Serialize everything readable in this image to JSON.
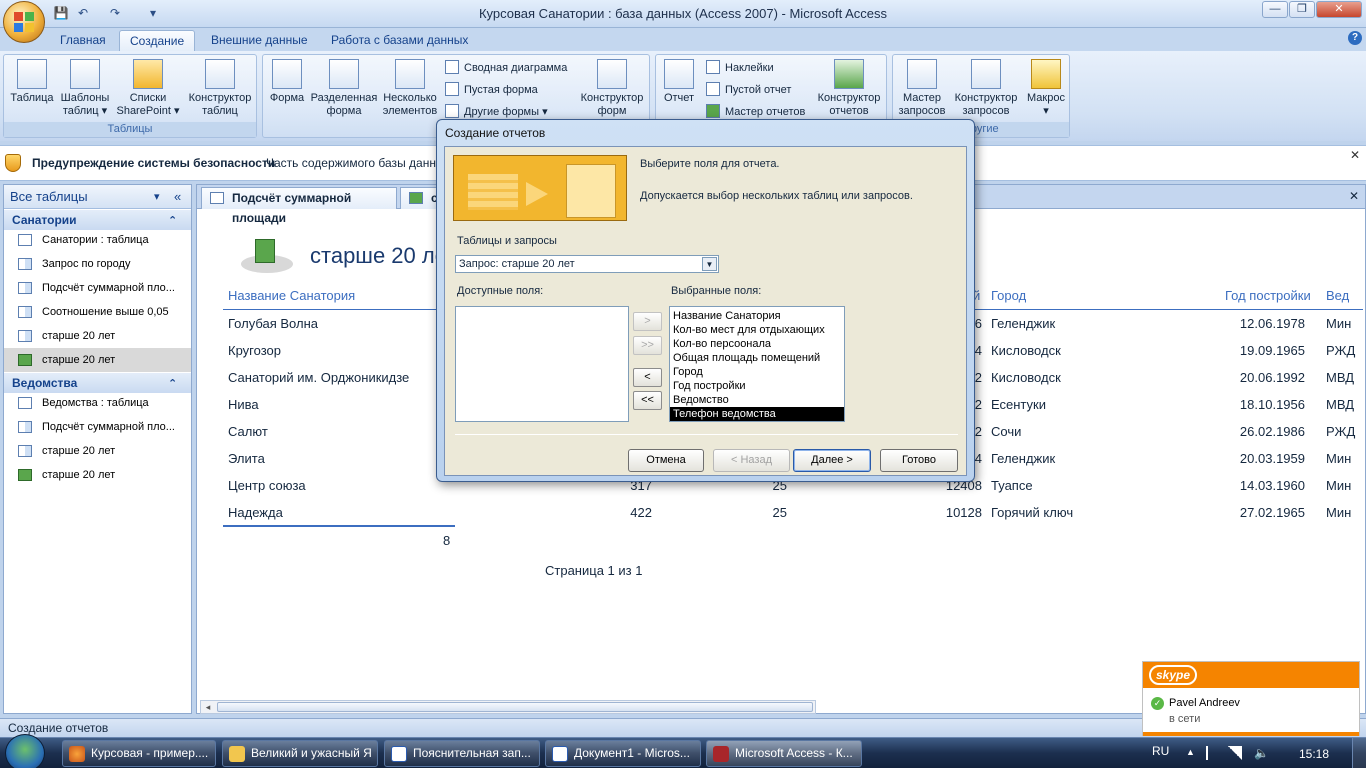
{
  "window": {
    "title": "Курсовая Санатории : база данных (Access 2007) - Microsoft Access"
  },
  "qat": {
    "save": "💾",
    "undo": "↶",
    "redo": "↷",
    "more": "▾"
  },
  "winbuttons": {
    "minimize": "—",
    "maximize": "❐",
    "close": "✕"
  },
  "ribbon_tabs": [
    "Главная",
    "Создание",
    "Внешние данные",
    "Работа с базами данных"
  ],
  "ribbon_help": "?",
  "ribbon": {
    "tables": {
      "label": "Таблицы",
      "btn1": "Таблица",
      "btn2a": "Шаблоны",
      "btn2b": "таблиц ▾",
      "btn3a": "Списки",
      "btn3b": "SharePoint ▾",
      "btn4a": "Конструктор",
      "btn4b": "таблиц"
    },
    "forms": {
      "btn1": "Форма",
      "btn2a": "Разделенная",
      "btn2b": "форма",
      "btn3a": "Несколько",
      "btn3b": "элементов",
      "s1": "Сводная диаграмма",
      "s2": "Пустая форма",
      "s3": "Другие формы ▾",
      "btn4a": "Конструктор",
      "btn4b": "форм"
    },
    "reports": {
      "btn1": "Отчет",
      "s1": "Наклейки",
      "s2": "Пустой отчет",
      "s3": "Мастер отчетов",
      "btn2a": "Конструктор",
      "btn2b": "отчетов"
    },
    "other": {
      "label": "Другие",
      "btn1a": "Мастер",
      "btn1b": "запросов",
      "btn2a": "Конструктор",
      "btn2b": "запросов",
      "btn3": "Макрос",
      "btn3b": "▾"
    }
  },
  "security": {
    "title": "Предупреждение системы безопасности",
    "text": "Часть содержимого базы данны",
    "close": "✕"
  },
  "nav": {
    "header": "Все таблицы",
    "header_arrow": "▾",
    "header_collapse": "«",
    "group1": {
      "name": "Санатории",
      "toggle": "⌃",
      "items": [
        "Санатории : таблица",
        "Запрос по городу",
        "Подсчёт суммарной пло...",
        "Соотношение выше 0,05",
        "старше 20 лет",
        "старше 20 лет"
      ]
    },
    "group2": {
      "name": "Ведомства",
      "toggle": "⌃",
      "items": [
        "Ведомства : таблица",
        "Подсчёт суммарной пло...",
        "старше 20 лет",
        "старше 20 лет"
      ]
    }
  },
  "doc": {
    "tab1": "Подсчёт суммарной площади",
    "tab2": "с",
    "close": "✕",
    "report_title": "старше 20 ле",
    "headers": {
      "name": "Название Санатория",
      "col3": "й",
      "city": "Город",
      "year": "Год постройки",
      "ved": "Вед"
    },
    "rows": [
      {
        "name": "Голубая Волна",
        "c1": "",
        "c2": "",
        "c3": "6",
        "city": "Геленджик",
        "date": "12.06.1978",
        "ved": "Мин"
      },
      {
        "name": "Кругозор",
        "c1": "",
        "c2": "",
        "c3": "4",
        "city": "Кисловодск",
        "date": "19.09.1965",
        "ved": "РЖД"
      },
      {
        "name": "Санаторий им. Орджоникидзе",
        "c1": "",
        "c2": "",
        "c3": "2",
        "city": "Кисловодск",
        "date": "20.06.1992",
        "ved": "МВД"
      },
      {
        "name": "Нива",
        "c1": "",
        "c2": "",
        "c3": "2",
        "city": "Есентуки",
        "date": "18.10.1956",
        "ved": "МВД"
      },
      {
        "name": "Салют",
        "c1": "",
        "c2": "",
        "c3": "2",
        "city": "Сочи",
        "date": "26.02.1986",
        "ved": "РЖД"
      },
      {
        "name": "Элита",
        "c1": "",
        "c2": "",
        "c3": "4",
        "city": "Геленджик",
        "date": "20.03.1959",
        "ved": "Мин"
      },
      {
        "name": "Центр союза",
        "c1": "317",
        "c2": "25",
        "c3": "12408",
        "city": "Туапсе",
        "date": "14.03.1960",
        "ved": "Мин"
      },
      {
        "name": "Надежда",
        "c1": "422",
        "c2": "25",
        "c3": "10128",
        "city": "Горячий ключ",
        "date": "27.02.1965",
        "ved": "Мин"
      }
    ],
    "count": "8",
    "page": "Страница 1 из 1"
  },
  "dialog": {
    "title": "Создание отчетов",
    "intro1": "Выберите поля для отчета.",
    "intro2": "Допускается выбор нескольких таблиц или запросов.",
    "tables_label": "Таблицы и запросы",
    "tables_value": "Запрос: старше 20 лет",
    "available_label": "Доступные поля:",
    "selected_label": "Выбранные поля:",
    "available_fields": [],
    "selected_fields": [
      "Название Санатория",
      "Кол-во мест для отдыхающих",
      "Кол-во персоонала",
      "Общая площадь помещений",
      "Город",
      "Год постройки",
      "Ведомство",
      "Телефон ведомства"
    ],
    "btn_add": ">",
    "btn_add_all": ">>",
    "btn_remove": "<",
    "btn_remove_all": "<<",
    "cancel": "Отмена",
    "back": "< Назад",
    "next": "Далее >",
    "finish": "Готово"
  },
  "statusbar": {
    "text": "Создание отчетов"
  },
  "skype": {
    "logo": "skype",
    "name": "Pavel Andreev",
    "status": "в сети"
  },
  "taskbar": {
    "items": [
      "Курсовая - пример....",
      "Великий и ужасный Я",
      "Пояснительная зап...",
      "Документ1 - Micros...",
      "Microsoft Access - К..."
    ],
    "lang": "RU",
    "time": "15:18"
  },
  "colors": {
    "accent": "#15428b",
    "report_header": "#3c6ec0",
    "skype": "#f58400",
    "selected": "#000000"
  }
}
